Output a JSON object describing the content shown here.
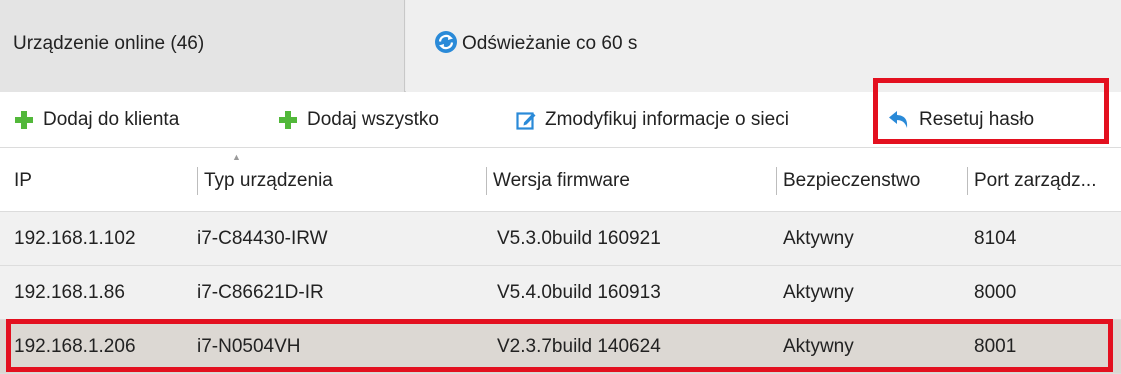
{
  "tabs": {
    "online_label": "Urządzenie online (46)",
    "refresh_label": "Odświeżanie co 60 s",
    "refresh_icon": "refresh-icon"
  },
  "toolbar": {
    "add_label": "Dodaj do klienta",
    "add_all_label": "Dodaj wszystko",
    "modify_label": "Zmodyfikuj informacje o sieci",
    "reset_label": "Resetuj hasło",
    "add_icon": "plus-icon",
    "modify_icon": "edit-icon",
    "reset_icon": "undo-arrow-icon"
  },
  "table": {
    "columns": [
      "IP",
      "Typ urządzenia",
      "Wersja firmware",
      "Bezpieczenstwo",
      "Port zarządz..."
    ],
    "sorted_column": "Typ urządzenia",
    "rows": [
      {
        "ip": "192.168.1.102",
        "type": "i7-C84430-IRW",
        "firmware": "V5.3.0build 160921",
        "security": "Aktywny",
        "port": "8104"
      },
      {
        "ip": "192.168.1.86",
        "type": "i7-C86621D-IR",
        "firmware": "V5.4.0build 160913",
        "security": "Aktywny",
        "port": "8000"
      },
      {
        "ip": "192.168.1.206",
        "type": "i7-N0504VH",
        "firmware": "V2.3.7build 140624",
        "security": "Aktywny",
        "port": "8001"
      }
    ]
  },
  "colors": {
    "highlight": "#e3101f",
    "plus_green": "#52b83a",
    "icon_blue": "#2a8ad8",
    "selected_row": "#dcd8d3"
  }
}
